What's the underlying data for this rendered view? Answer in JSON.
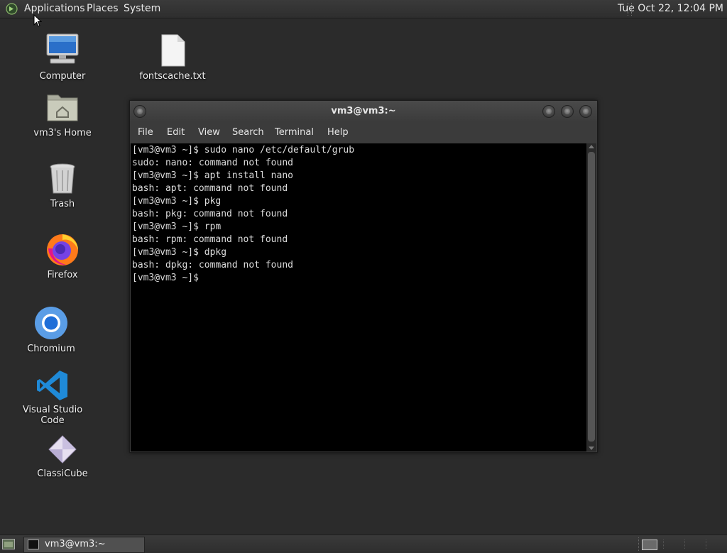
{
  "top_panel": {
    "menus": [
      "Applications",
      "Places",
      "System"
    ],
    "clock": "Tue Oct 22, 12:04 PM"
  },
  "desktop": {
    "icons": [
      {
        "label": "Computer",
        "icon": "computer-icon"
      },
      {
        "label": "fontscache.txt",
        "icon": "text-file-icon"
      },
      {
        "label": "vm3's Home",
        "icon": "home-folder-icon"
      },
      {
        "label": "Trash",
        "icon": "trash-icon"
      },
      {
        "label": "Firefox",
        "icon": "firefox-icon"
      },
      {
        "label": "Chromium",
        "icon": "chromium-icon"
      },
      {
        "label": "Visual Studio Code",
        "icon": "vscode-icon"
      },
      {
        "label": "ClassiCube",
        "icon": "classicube-icon"
      }
    ]
  },
  "terminal": {
    "title": "vm3@vm3:~",
    "menus": [
      "File",
      "Edit",
      "View",
      "Search",
      "Terminal",
      "Help"
    ],
    "lines": [
      "[vm3@vm3 ~]$ sudo nano /etc/default/grub",
      "sudo: nano: command not found",
      "[vm3@vm3 ~]$ apt install nano",
      "bash: apt: command not found",
      "[vm3@vm3 ~]$ pkg",
      "bash: pkg: command not found",
      "[vm3@vm3 ~]$ rpm",
      "bash: rpm: command not found",
      "[vm3@vm3 ~]$ dpkg",
      "bash: dpkg: command not found",
      "[vm3@vm3 ~]$"
    ]
  },
  "taskbar": {
    "window_label": "vm3@vm3:~"
  },
  "colors": {
    "desktop_bg": "#2b2b2b",
    "panel_bg": "#333333",
    "terminal_bg": "#000000",
    "terminal_fg": "#dcdcdc"
  }
}
